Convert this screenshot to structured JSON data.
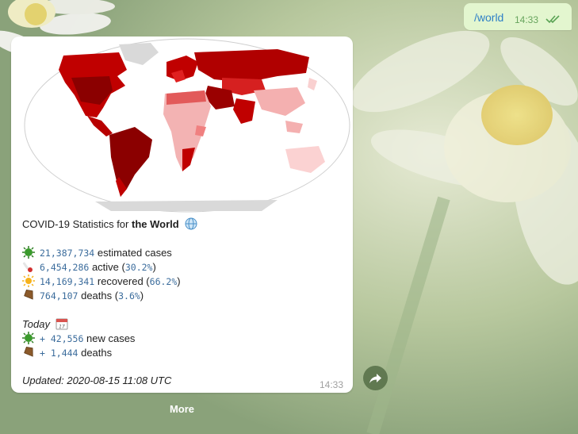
{
  "outgoing_message": {
    "text": "/world",
    "time": "14:33"
  },
  "stats_message": {
    "title_prefix": "COVID-19 Statistics for ",
    "title_bold": "the World",
    "title_icon": "globe-icon",
    "rows": [
      {
        "icon": "virus-icon",
        "value": "21,387,734",
        "label": "estimated cases",
        "pct": ""
      },
      {
        "icon": "thermometer-icon",
        "value": "6,454,286",
        "label": "active",
        "pct": "30.2%"
      },
      {
        "icon": "sun-icon",
        "value": "14,169,341",
        "label": "recovered",
        "pct": "66.2%"
      },
      {
        "icon": "coffin-icon",
        "value": "764,107",
        "label": "deaths",
        "pct": "3.6%"
      }
    ],
    "today_label": "Today",
    "today_rows": [
      {
        "icon": "virus-icon",
        "value": "+ 42,556",
        "label": "new cases"
      },
      {
        "icon": "coffin-icon",
        "value": "+ 1,444",
        "label": "deaths"
      }
    ],
    "updated": "Updated: 2020-08-15 11:08 UTC",
    "time": "14:33"
  },
  "more_button": "More",
  "colors": {
    "accent_link": "#2f80c7",
    "map_dark": "#8b0000",
    "map_mid": "#d7191c",
    "map_light": "#f4a6a6",
    "map_none": "#d9d9d9"
  }
}
